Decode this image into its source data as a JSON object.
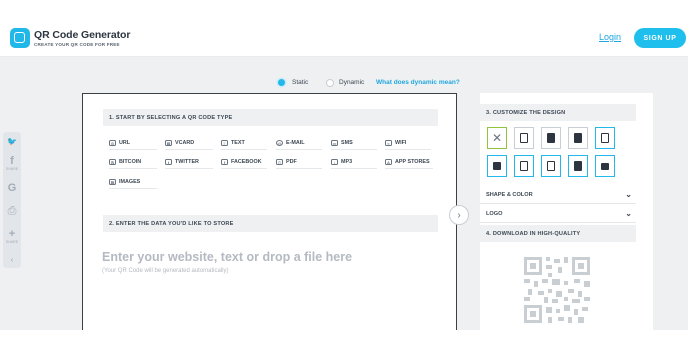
{
  "header": {
    "logo_title": "QR Code Generator",
    "logo_subtitle": "CREATE YOUR QR CODE FOR FREE",
    "login_label": "Login",
    "signup_label": "SIGN UP"
  },
  "social": {
    "items": [
      {
        "icon": "twitter-icon",
        "glyph": "🐦",
        "label": ""
      },
      {
        "icon": "facebook-icon",
        "glyph": "f",
        "label": "SHARE"
      },
      {
        "icon": "google-icon",
        "glyph": "G",
        "label": ""
      },
      {
        "icon": "print-icon",
        "glyph": "⎙",
        "label": ""
      },
      {
        "icon": "plus-icon",
        "glyph": "+",
        "label": "SHARE"
      },
      {
        "icon": "collapse-icon",
        "glyph": "‹",
        "label": ""
      }
    ]
  },
  "mode": {
    "static_label": "Static",
    "dynamic_label": "Dynamic",
    "what_link": "What does dynamic mean?",
    "selected": "static"
  },
  "left": {
    "step1_title": "1. START BY SELECTING A QR CODE TYPE",
    "types": [
      {
        "label": "URL",
        "icon": "url-icon"
      },
      {
        "label": "VCARD",
        "icon": "vcard-icon"
      },
      {
        "label": "TEXT",
        "icon": "text-icon"
      },
      {
        "label": "E-MAIL",
        "icon": "email-icon"
      },
      {
        "label": "SMS",
        "icon": "sms-icon"
      },
      {
        "label": "WIFI",
        "icon": "wifi-icon"
      },
      {
        "label": "BITCOIN",
        "icon": "bitcoin-icon"
      },
      {
        "label": "TWITTER",
        "icon": "twitter-icon"
      },
      {
        "label": "FACEBOOK",
        "icon": "facebook-icon"
      },
      {
        "label": "PDF",
        "icon": "pdf-icon"
      },
      {
        "label": "MP3",
        "icon": "mp3-icon"
      },
      {
        "label": "APP STORES",
        "icon": "app-stores-icon"
      },
      {
        "label": "IMAGES",
        "icon": "images-icon"
      }
    ],
    "step2_title": "2. ENTER THE DATA YOU'D LIKE TO STORE",
    "input_placeholder": "Enter your website, text or drop a file here",
    "input_hint": "(Your QR Code will be generated automatically)"
  },
  "right": {
    "step3_title": "3. CUSTOMIZE THE DESIGN",
    "shape_color_label": "SHAPE & COLOR",
    "logo_label": "LOGO",
    "step4_title": "4. DOWNLOAD IN HIGH-QUALITY"
  },
  "colors": {
    "accent": "#1ebfec",
    "selected_frame": "#8fc43c",
    "panel_bg": "#eef0f2"
  }
}
